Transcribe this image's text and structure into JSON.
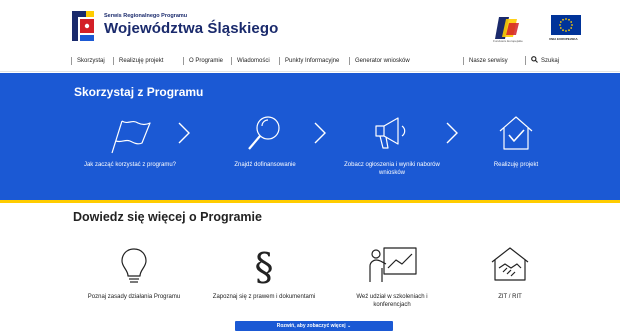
{
  "header": {
    "subtitle": "Serwis Regionalnego Programu",
    "title": "Województwa Śląskiego",
    "fe_caption": "Fundusze Europejskie",
    "eu_caption": "UNIA EUROPEJSKA",
    "colors": {
      "navy": "#1a2a6c",
      "eu_blue": "#003399",
      "star": "#ffcc00"
    }
  },
  "nav": {
    "items": [
      "Skorzystaj",
      "Realizuję projekt",
      "O Programie",
      "Wiadomości",
      "Punkty Informacyjne",
      "Generator wniosków"
    ],
    "other_services": "Nasze serwisy",
    "search_label": "Szukaj"
  },
  "band": {
    "title": "Skorzystaj z Programu",
    "background": "#1b59d4",
    "accent": "#ffcc00",
    "steps": [
      {
        "label": "Jak zacząć korzystać z programu?",
        "icon": "flag-icon"
      },
      {
        "label": "Znajdź dofinansowanie",
        "icon": "magnifier-icon"
      },
      {
        "label": "Zobacz ogłoszenia i wyniki naborów wniosków",
        "icon": "megaphone-icon"
      },
      {
        "label": "Realizuję projekt",
        "icon": "house-check-icon"
      }
    ]
  },
  "learn": {
    "title": "Dowiedz się więcej o Programie",
    "items": [
      {
        "label": "Poznaj zasady działania Programu",
        "icon": "lightbulb-icon"
      },
      {
        "label": "Zapoznaj się z prawem i dokumentami",
        "icon": "paragraph-icon"
      },
      {
        "label": "Weź udział w szkoleniach i konferencjach",
        "icon": "presentation-icon"
      },
      {
        "label": "ZIT / RIT",
        "icon": "handshake-house-icon"
      }
    ],
    "expand_label": "Rozwiń, aby zobaczyć więcej"
  }
}
